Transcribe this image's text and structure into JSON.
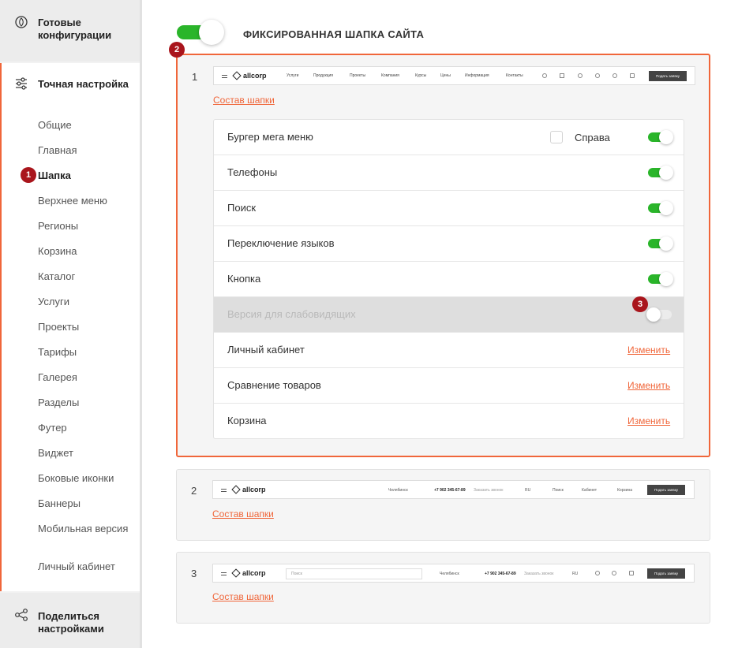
{
  "sidebar": {
    "ready_configs": "Готовые конфигурации",
    "fine_tuning": "Точная настройка",
    "share_settings": "Поделиться настройками",
    "items": [
      {
        "label": "Общие"
      },
      {
        "label": "Главная"
      },
      {
        "label": "Шапка",
        "active": true
      },
      {
        "label": "Верхнее меню"
      },
      {
        "label": "Регионы"
      },
      {
        "label": "Корзина"
      },
      {
        "label": "Каталог"
      },
      {
        "label": "Услуги"
      },
      {
        "label": "Проекты"
      },
      {
        "label": "Тарифы"
      },
      {
        "label": "Галерея"
      },
      {
        "label": "Разделы"
      },
      {
        "label": "Футер"
      },
      {
        "label": "Виджет"
      },
      {
        "label": "Боковые иконки"
      },
      {
        "label": "Баннеры"
      },
      {
        "label": "Мобильная версия"
      },
      {
        "label": "Личный кабинет"
      }
    ]
  },
  "badges": {
    "one": "1",
    "two": "2",
    "three": "3"
  },
  "main": {
    "title": "ФИКСИРОВАННАЯ ШАПКА САЙТА",
    "fixed_header_enabled": true,
    "composition_link": "Состав шапки",
    "change_link": "Изменить",
    "variants": [
      {
        "number": "1",
        "logo": "allcorp",
        "nav": [
          "Услуги",
          "Продукция",
          "Проекты",
          "Компания",
          "Курсы",
          "Цены",
          "Информация",
          "Контакты"
        ],
        "button": "Подать заявку"
      },
      {
        "number": "2",
        "logo": "allcorp",
        "city": "Челябинск",
        "phone": "+7 902 345-67-89",
        "callback": "Заказать звонок",
        "lang": "RU",
        "search": "Поиск",
        "cabinet": "Кабинет",
        "cart": "Корзина",
        "button": "Подать заявку"
      },
      {
        "number": "3",
        "logo": "allcorp",
        "search_placeholder": "Поиск",
        "city": "Челябинск",
        "phone": "+7 902 345-67-89",
        "callback": "Заказать звонок",
        "lang": "RU",
        "button": "Подать заявку"
      }
    ],
    "options": [
      {
        "label": "Бургер мега меню",
        "checkbox_label": "Справа",
        "checkbox_checked": false,
        "enabled": true
      },
      {
        "label": "Телефоны",
        "enabled": true
      },
      {
        "label": "Поиск",
        "enabled": true
      },
      {
        "label": "Переключение языков",
        "enabled": true
      },
      {
        "label": "Кнопка",
        "enabled": true
      },
      {
        "label": "Версия для слабовидящих",
        "enabled": false,
        "disabled": true
      },
      {
        "label": "Личный кабинет"
      },
      {
        "label": "Сравнение товаров"
      },
      {
        "label": "Корзина"
      }
    ]
  },
  "colors": {
    "accent": "#f0663a",
    "toggle_on": "#2ab52a",
    "badge": "#a9151c"
  }
}
